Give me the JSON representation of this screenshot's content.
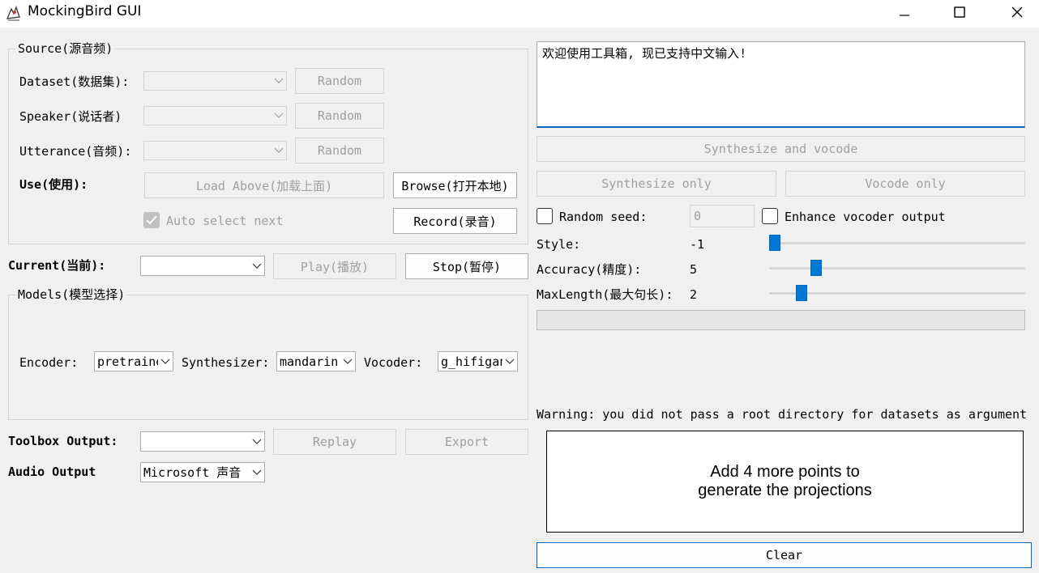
{
  "window": {
    "title": "MockingBird GUI"
  },
  "source": {
    "title": "Source(源音频)",
    "dataset_label": "Dataset(数据集):",
    "speaker_label": "Speaker(说话者)",
    "utterance_label": "Utterance(音频):",
    "random_label": "Random",
    "use_label": "Use(使用):",
    "load_above_label": "Load Above(加载上面)",
    "browse_label": "Browse(打开本地)",
    "auto_select_label": "Auto select next",
    "record_label": "Record(录音)"
  },
  "current": {
    "label": "Current(当前):",
    "play_label": "Play(播放)",
    "stop_label": "Stop(暂停)"
  },
  "models": {
    "title": "Models(模型选择)",
    "encoder_label": "Encoder:",
    "encoder_value": "pretrained",
    "synthesizer_label": "Synthesizer:",
    "synthesizer_value": "mandarin",
    "vocoder_label": "Vocoder:",
    "vocoder_value": "g_hifigan"
  },
  "toolbox_output": {
    "label": "Toolbox Output:",
    "replay_label": "Replay",
    "export_label": "Export"
  },
  "audio_output": {
    "label": "Audio Output",
    "value": "Microsoft 声音"
  },
  "synthesis": {
    "text": "欢迎使用工具箱, 现已支持中文输入!",
    "synth_vocode_label": "Synthesize and vocode",
    "synth_only_label": "Synthesize only",
    "vocode_only_label": "Vocode only",
    "random_seed_label": "Random seed:",
    "random_seed_value": "0",
    "enhance_label": "Enhance vocoder output",
    "style_label": "Style:",
    "style_value": "-1",
    "accuracy_label": "Accuracy(精度):",
    "accuracy_value": "5",
    "maxlength_label": "MaxLength(最大句长):",
    "maxlength_value": "2"
  },
  "log": {
    "warning": "Warning: you did not pass a root directory for datasets as argument"
  },
  "projections": {
    "line1": "Add 4 more points to",
    "line2": "generate the projections",
    "clear_label": "Clear"
  }
}
